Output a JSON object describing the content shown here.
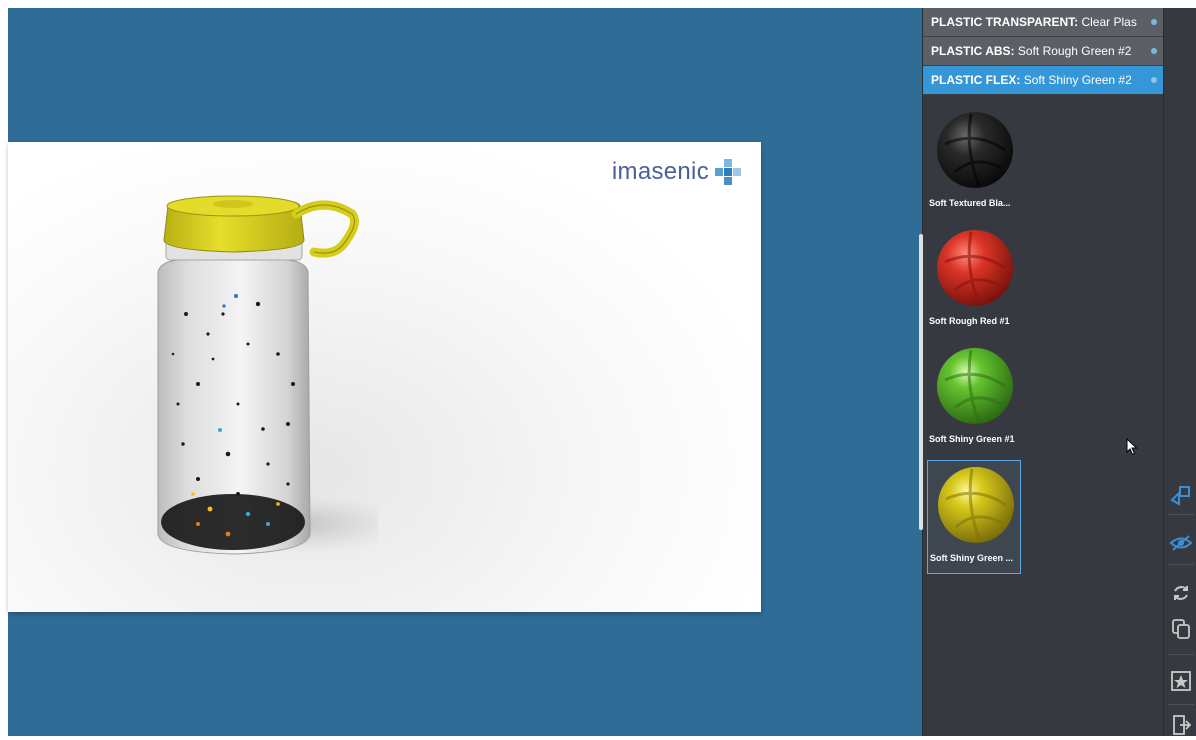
{
  "brand": {
    "name": "imasenic"
  },
  "materials": {
    "rows": [
      {
        "key": "PLASTIC TRANSPARENT:",
        "value": "Clear Plas"
      },
      {
        "key": "PLASTIC ABS:",
        "value": "Soft Rough Green #2"
      },
      {
        "key": "PLASTIC FLEX:",
        "value": "Soft Shiny Green #2"
      }
    ],
    "swatches": [
      {
        "label": "Soft Textured Bla...",
        "color": "#1c1c1c"
      },
      {
        "label": "Soft Rough Red #1",
        "color": "#d9362a"
      },
      {
        "label": "Soft Shiny Green #1",
        "color": "#5cb82d"
      },
      {
        "label": "Soft Shiny Green ...",
        "color": "#d7c81c"
      }
    ]
  },
  "toolbar": {
    "icons": [
      "cube-shapes-icon",
      "visibility-icon",
      "refresh-icon",
      "copy-icon",
      "favorite-image-icon",
      "exit-icon"
    ]
  },
  "colors": {
    "viewport_bg": "#2f6c96",
    "panel_bg": "#363a40",
    "accent_blue": "#3596d8",
    "cap_yellow": "#d9d21c",
    "brand_blue": "#4a5e9a"
  }
}
